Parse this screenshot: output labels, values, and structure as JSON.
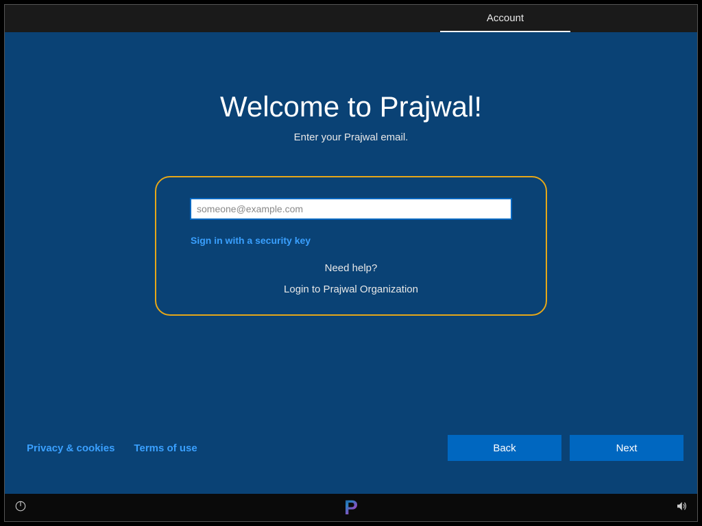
{
  "header": {
    "active_tab": "Account"
  },
  "main": {
    "title": "Welcome to Prajwal!",
    "subtitle": "Enter your Prajwal email.",
    "email_placeholder": "someone@example.com",
    "security_key": "Sign in with a security key",
    "need_help": "Need help?",
    "org_login": "Login to Prajwal Organization"
  },
  "footer": {
    "privacy": "Privacy & cookies",
    "terms": "Terms of use"
  },
  "nav": {
    "back": "Back",
    "next": "Next"
  },
  "logo": "P"
}
